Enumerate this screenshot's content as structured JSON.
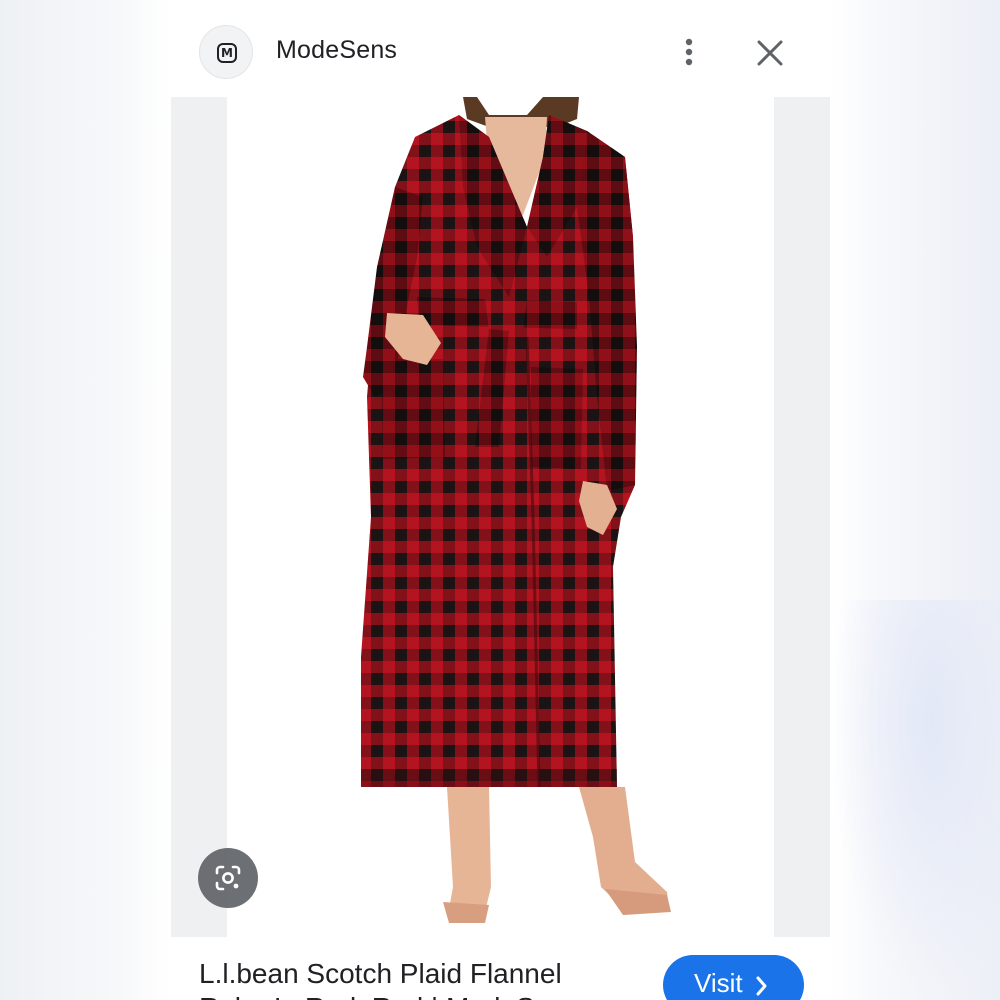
{
  "header": {
    "logo_letter": "M",
    "site_name": "ModeSens",
    "more_icon": "more-vert-icon",
    "close_icon": "close-icon"
  },
  "image": {
    "subject": "red-black-plaid-flannel-robe",
    "lens_icon": "google-lens-icon"
  },
  "product": {
    "title_line1": "L.l.bean Scotch Plaid Flannel",
    "title_line2": "Robe In Red. Red | ModeSens"
  },
  "actions": {
    "visit_label": "Visit",
    "visit_icon": "chevron-right-icon"
  },
  "colors": {
    "accent": "#1a73e8",
    "plaid_red": "#b3141f",
    "plaid_dark": "#2a1414",
    "text": "#202124"
  }
}
